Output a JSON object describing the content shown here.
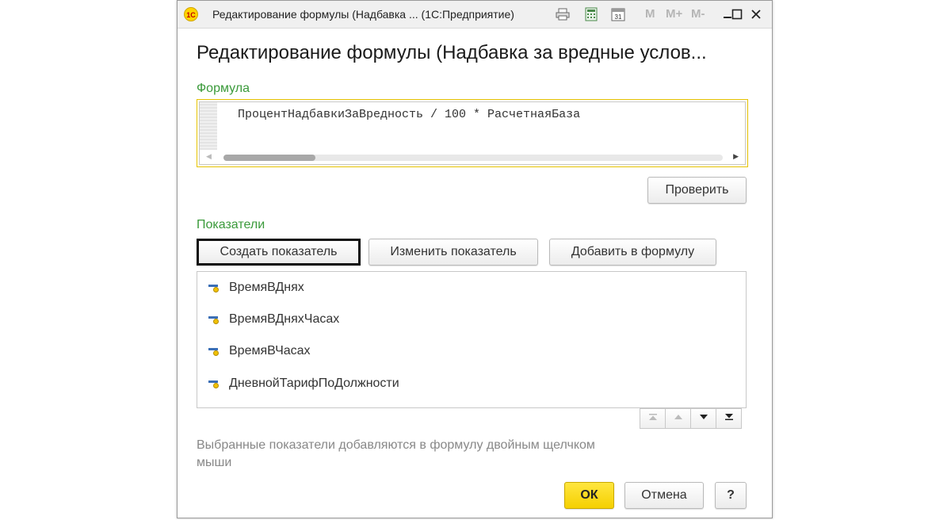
{
  "window": {
    "title": "Редактирование формулы (Надбавка ... (1С:Предприятие)",
    "logo_text": "1С",
    "toolbar_icons": [
      "print-icon",
      "calculator-icon",
      "calendar-icon"
    ],
    "calendar_day": "31",
    "memory_labels": [
      "M",
      "M+",
      "M-"
    ],
    "controls": [
      "minimize-icon",
      "maximize-icon",
      "close-icon"
    ]
  },
  "form": {
    "title": "Редактирование формулы (Надбавка за вредные услов..."
  },
  "formula": {
    "label": "Формула",
    "value": "ПроцентНадбавкиЗаВредность / 100 * РасчетнаяБаза"
  },
  "check_button": "Проверить",
  "indicators": {
    "label": "Показатели",
    "buttons": {
      "create": "Создать показатель",
      "edit": "Изменить показатель",
      "add": "Добавить в формулу"
    },
    "items": [
      "ВремяВДнях",
      "ВремяВДняхЧасах",
      "ВремяВЧасах",
      "ДневнойТарифПоДолжности"
    ]
  },
  "hint": "Выбранные показатели добавляются в формулу двойным щелчком мыши",
  "footer": {
    "ok": "ОК",
    "cancel": "Отмена",
    "help": "?"
  },
  "colors": {
    "accent_yellow": "#f5d000",
    "label_green": "#3a9a3a",
    "formula_border": "#e6c300"
  }
}
